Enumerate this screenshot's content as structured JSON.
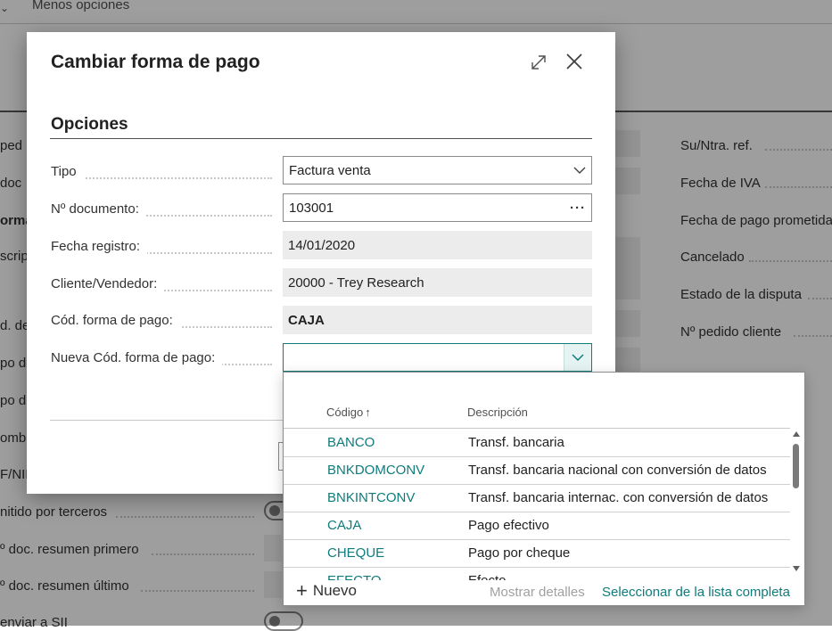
{
  "background": {
    "top_link": "Menos opciones",
    "left_labels": [
      "ped",
      "doc",
      "orma",
      "scrip",
      "d. de",
      "po de",
      "po de",
      "ombr",
      "F/NIF",
      "nitido por terceros",
      "º doc. resumen primero",
      "º doc. resumen último",
      "enviar a SII"
    ],
    "right_labels": [
      "Su/Ntra. ref.",
      "Fecha de IVA",
      "Fecha de pago prometida",
      "Cancelado",
      "Estado de la disputa",
      "Nº pedido cliente"
    ]
  },
  "dialog": {
    "title": "Cambiar forma de pago",
    "section": "Opciones",
    "fields": [
      {
        "label": "Tipo",
        "value": "Factura venta"
      },
      {
        "label": "Nº documento:",
        "value": "103001"
      },
      {
        "label": "Fecha registro:",
        "value": "14/01/2020"
      },
      {
        "label": "Cliente/Vendedor:",
        "value": "20000 - Trey Research"
      },
      {
        "label": "Cód. forma de pago:",
        "value": "CAJA"
      },
      {
        "label": "Nueva Cód. forma de pago:",
        "value": ""
      }
    ]
  },
  "lookup": {
    "columns": {
      "code": "Código",
      "sort_indicator": "↑",
      "description": "Descripción"
    },
    "rows": [
      {
        "code": "BANCO",
        "description": "Transf. bancaria"
      },
      {
        "code": "BNKDOMCONV",
        "description": "Transf. bancaria nacional con conversión de datos"
      },
      {
        "code": "BNKINTCONV",
        "description": "Transf. bancaria internac. con conversión de datos"
      },
      {
        "code": "CAJA",
        "description": "Pago efectivo"
      },
      {
        "code": "CHEQUE",
        "description": "Pago por cheque"
      },
      {
        "code": "EFECTO",
        "description": "Efecto"
      }
    ],
    "new_label": "Nuevo",
    "details_label": "Mostrar detalles",
    "full_list_label": "Seleccionar de la lista completa"
  },
  "icons": [
    "chevron-down-icon",
    "expand-icon",
    "close-icon",
    "ellipsis-icon",
    "plus-icon",
    "arrow-up-icon"
  ],
  "colors": {
    "accent": "#0f7b7b",
    "overlay": "rgba(0,0,0,0.38)",
    "readonly_field": "#ececec"
  }
}
